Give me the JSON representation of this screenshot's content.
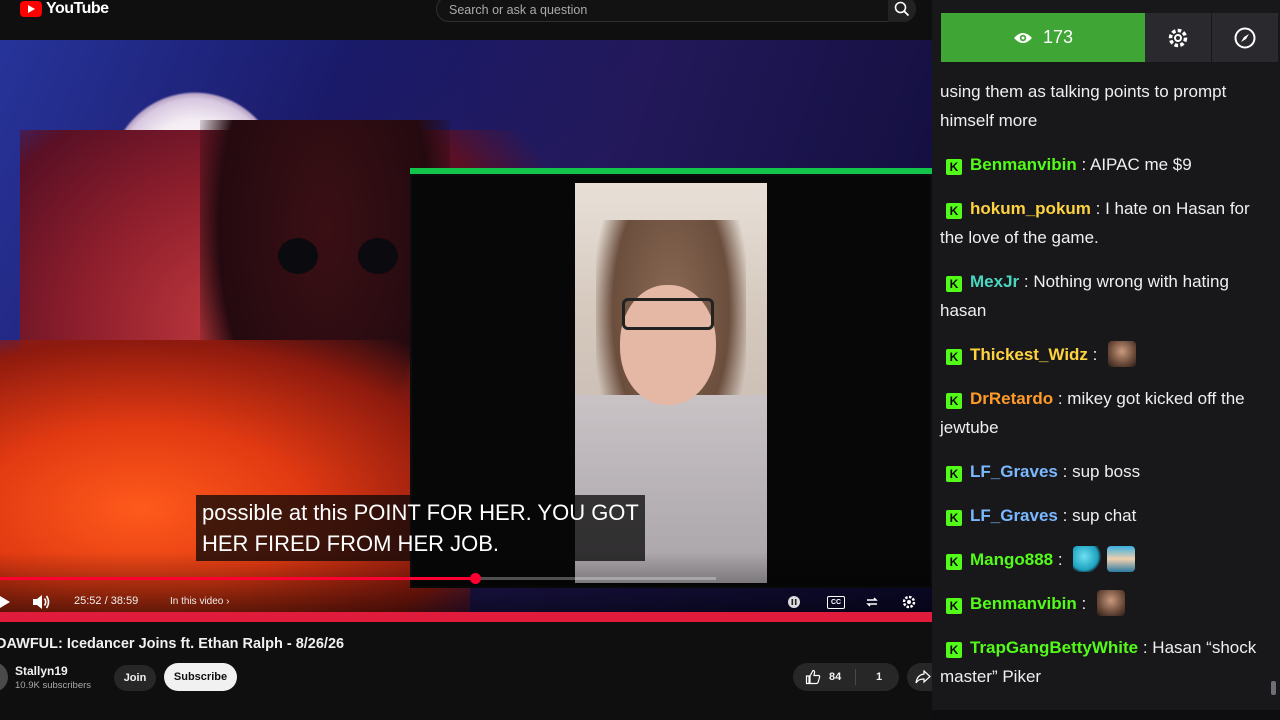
{
  "youtube": {
    "logo_text": "YouTube",
    "search_placeholder": "Search or ask a question"
  },
  "player": {
    "subtitle_lines": [
      "possible at this POINT FOR HER. YOU GOT",
      "HER FIRED FROM HER JOB."
    ],
    "time_display": "25:52 / 38:59",
    "chapter_label": "In this video",
    "progress_fraction": 0.663
  },
  "video_info": {
    "title": "DAWFUL: Icedancer Joins ft. Ethan Ralph - 8/26/26",
    "channel_name": "Stallyn19",
    "subscriber_count": "10.9K subscribers",
    "join_label": "Join",
    "subscribe_label": "Subscribe",
    "like_count": "84",
    "dislike_count": "1"
  },
  "chat": {
    "viewer_count": "173",
    "accent_color": "#3fa535",
    "badge_letter": "K",
    "messages": [
      {
        "user": "",
        "text": "using them as talking points to prompt himself more",
        "partial": true
      },
      {
        "user": "Benmanvibin",
        "color": "#53fc18",
        "text": "AIPAC me $9"
      },
      {
        "user": "hokum_pokum",
        "color": "#ffd23f",
        "text": "I hate on Hasan for the love of the game."
      },
      {
        "user": "MexJr",
        "color": "#4ad7c2",
        "text": "Nothing wrong with hating hasan"
      },
      {
        "user": "Thickest_Widz",
        "color": "#ffd23f",
        "text": "",
        "emotes": [
          "emote-face"
        ]
      },
      {
        "user": "DrRetardo",
        "color": "#ff9a28",
        "text": "mikey got kicked off the jewtube"
      },
      {
        "user": "LF_Graves",
        "color": "#7ab8ff",
        "text": "sup boss"
      },
      {
        "user": "LF_Graves",
        "color": "#7ab8ff",
        "text": "sup chat"
      },
      {
        "user": "Mango888",
        "color": "#53fc18",
        "text": "",
        "emotes": [
          "emote-dolphin",
          "emote-character"
        ]
      },
      {
        "user": "Benmanvibin",
        "color": "#53fc18",
        "text": "",
        "emotes": [
          "emote-face"
        ]
      },
      {
        "user": "TrapGangBettyWhite",
        "color": "#53fc18",
        "text": "Hasan “shock master” Piker"
      }
    ]
  }
}
